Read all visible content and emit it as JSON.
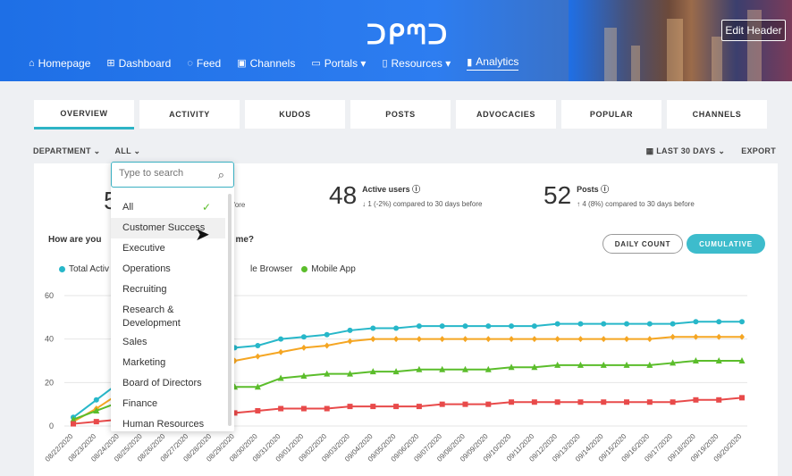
{
  "header": {
    "logo": "ᑐᑭᘉᑐ",
    "edit_header": "Edit Header",
    "nav": [
      {
        "icon": "⌂",
        "label": "Homepage"
      },
      {
        "icon": "⊞",
        "label": "Dashboard"
      },
      {
        "icon": "◌",
        "label": "Feed"
      },
      {
        "icon": "▣",
        "label": "Channels"
      },
      {
        "icon": "▭",
        "label": "Portals ▾"
      },
      {
        "icon": "▯",
        "label": "Resources ▾"
      },
      {
        "icon": "▮",
        "label": "Analytics"
      }
    ]
  },
  "tabs": [
    "OVERVIEW",
    "ACTIVITY",
    "KUDOS",
    "POSTS",
    "ADVOCACIES",
    "POPULAR",
    "CHANNELS"
  ],
  "filters": {
    "department": "DEPARTMENT ⌄",
    "all": "ALL ⌄",
    "range": "LAST 30 DAYS ⌄",
    "export": "EXPORT"
  },
  "stats": [
    {
      "big": "5",
      "label": "",
      "sub": "days before"
    },
    {
      "big": "48",
      "label": "Active users ⓘ",
      "sub": "↓  1 (-2%) compared to 30 days before"
    },
    {
      "big": "52",
      "label": "Posts ⓘ",
      "sub": "↑  4 (8%) compared to 30 days before"
    }
  ],
  "question": "How are you",
  "question_tail": "me?",
  "buttons": {
    "daily": "DAILY COUNT",
    "cumulative": "CUMULATIVE"
  },
  "legend": [
    {
      "label": "Total Activ",
      "color": "#27b7c9"
    },
    {
      "label": "le Browser",
      "color": "#f5a623"
    },
    {
      "label": "Mobile App",
      "color": "#5bbd2b"
    }
  ],
  "dropdown": {
    "placeholder": "Type to search",
    "options": [
      "All",
      "Customer Success",
      "Executive",
      "Operations",
      "Recruiting",
      "Research &\nDevelopment",
      "Sales",
      "Marketing",
      "Board of Directors",
      "Finance",
      "Human Resources"
    ]
  },
  "chart_data": {
    "type": "line",
    "x": [
      "08/22/2020",
      "08/23/2020",
      "08/24/2020",
      "08/25/2020",
      "08/26/2020",
      "08/27/2020",
      "08/28/2020",
      "08/29/2020",
      "08/30/2020",
      "08/31/2020",
      "09/01/2020",
      "09/02/2020",
      "09/03/2020",
      "09/04/2020",
      "09/05/2020",
      "09/06/2020",
      "09/07/2020",
      "09/08/2020",
      "09/09/2020",
      "09/10/2020",
      "09/11/2020",
      "09/12/2020",
      "09/13/2020",
      "09/14/2020",
      "09/15/2020",
      "09/16/2020",
      "09/17/2020",
      "09/18/2020",
      "09/19/2020",
      "09/20/2020"
    ],
    "ylim": [
      0,
      60
    ],
    "yticks": [
      0,
      20,
      40,
      60
    ],
    "series": [
      {
        "name": "Total Active",
        "color": "#27b7c9",
        "marker": "circle",
        "values": [
          4,
          12,
          20,
          25,
          30,
          33,
          36,
          36,
          37,
          40,
          41,
          42,
          44,
          45,
          45,
          46,
          46,
          46,
          46,
          46,
          46,
          47,
          47,
          47,
          47,
          47,
          47,
          48,
          48,
          48
        ]
      },
      {
        "name": "Mobile Browser",
        "color": "#f5a623",
        "marker": "diamond",
        "values": [
          2,
          8,
          15,
          20,
          25,
          28,
          30,
          30,
          32,
          34,
          36,
          37,
          39,
          40,
          40,
          40,
          40,
          40,
          40,
          40,
          40,
          40,
          40,
          40,
          40,
          40,
          41,
          41,
          41,
          41
        ]
      },
      {
        "name": "Mobile App",
        "color": "#5bbd2b",
        "marker": "triangle",
        "values": [
          3,
          7,
          11,
          14,
          16,
          17,
          18,
          18,
          18,
          22,
          23,
          24,
          24,
          25,
          25,
          26,
          26,
          26,
          26,
          27,
          27,
          28,
          28,
          28,
          28,
          28,
          29,
          30,
          30,
          30
        ]
      },
      {
        "name": "",
        "color": "#e84a4a",
        "marker": "square",
        "values": [
          1,
          2,
          3,
          4,
          4,
          5,
          5,
          6,
          7,
          8,
          8,
          8,
          9,
          9,
          9,
          9,
          10,
          10,
          10,
          11,
          11,
          11,
          11,
          11,
          11,
          11,
          11,
          12,
          12,
          13
        ]
      }
    ]
  }
}
